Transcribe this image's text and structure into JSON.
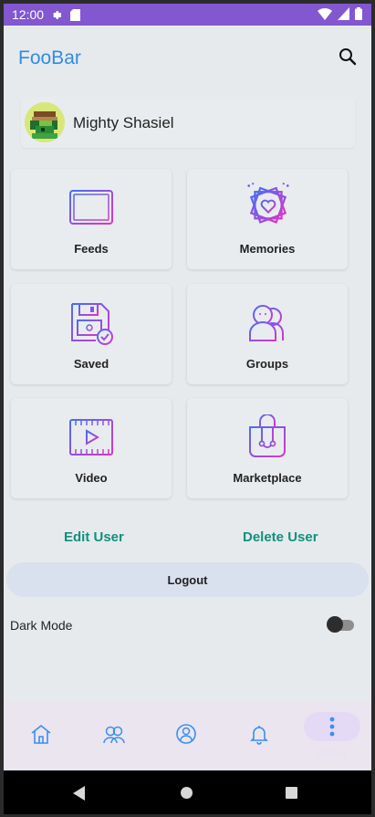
{
  "status_bar": {
    "time": "12:00"
  },
  "app_bar": {
    "title": "FooBar"
  },
  "profile": {
    "name": "Mighty Shasiel"
  },
  "tiles": [
    {
      "label": "Feeds"
    },
    {
      "label": "Memories"
    },
    {
      "label": "Saved"
    },
    {
      "label": "Groups"
    },
    {
      "label": "Video"
    },
    {
      "label": "Marketplace"
    }
  ],
  "actions": {
    "edit_user": "Edit User",
    "delete_user": "Delete User",
    "logout": "Logout"
  },
  "settings": {
    "dark_mode_label": "Dark Mode",
    "dark_mode_enabled": false
  },
  "bottom_nav": {
    "items": [
      "home-icon",
      "friends-icon",
      "profile-icon",
      "bell-icon",
      "more-vertical-icon"
    ],
    "selected": "more-vertical-icon",
    "more_label": "Menu"
  },
  "colors": {
    "status_bar": "#8257cf",
    "title_blue": "#2f8de4",
    "link_teal": "#0f9080",
    "icon_gradient_start": "#4a6cf7",
    "icon_gradient_end": "#d637c9"
  }
}
